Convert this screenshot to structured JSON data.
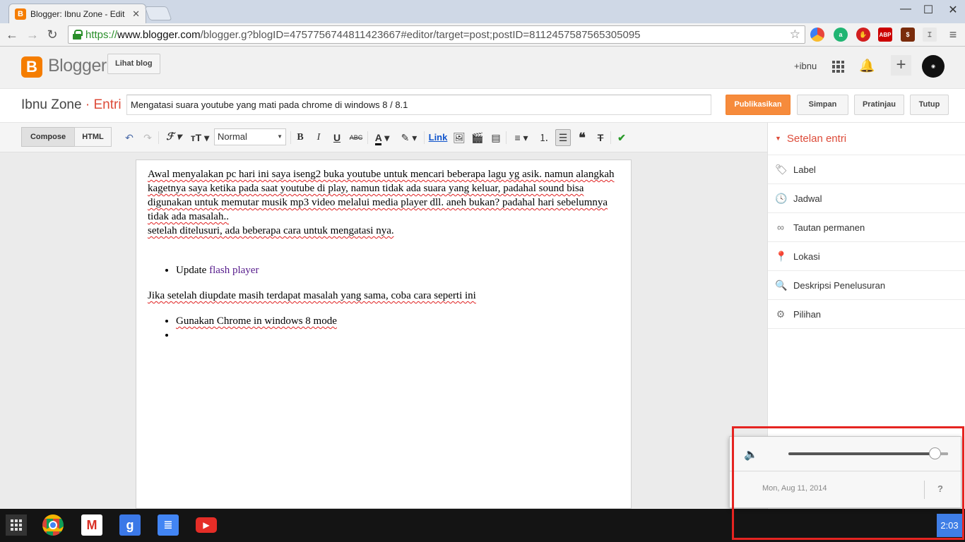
{
  "browser": {
    "tab_title": "Blogger: Ibnu Zone - Edit",
    "url_scheme": "https://",
    "url_host": "www.blogger.com",
    "url_rest": "/blogger.g?blogID=4757756744811423667#editor/target=post;postID=8112457587565305095",
    "extensions": [
      "ABP"
    ]
  },
  "blogger": {
    "logo_word": "Blogger",
    "view_blog": "Lihat blog",
    "user": "+ibnu",
    "blog_name": "Ibnu Zone",
    "section": "Entri",
    "post_title": "Mengatasi suara youtube yang mati pada chrome di windows 8 / 8.1",
    "publish": "Publikasikan",
    "save": "Simpan",
    "preview": "Pratinjau",
    "close": "Tutup"
  },
  "editor": {
    "mode_compose": "Compose",
    "mode_html": "HTML",
    "format_select": "Normal",
    "link_label": "Link"
  },
  "content": {
    "p1_a": "Awal menyalakan pc hari ini saya iseng2 buka youtube untuk mencari beberapa lagu yg asik. namun alangkah kagetnya saya ketika pada saat youtube di play, namun tidak ada suara yang keluar, padahal sound bisa digunakan untuk memutar musik mp3 video melalui media player dll. aneh bukan? padahal hari sebelumnya tidak ada masalah..",
    "p1_b": "setelah ditelusuri, ada beberapa cara untuk mengatasi nya.",
    "bullet1_prefix": "Update ",
    "bullet1_link": "flash player",
    "p2": "Jika setelah diupdate masih terdapat masalah yang sama, coba cara seperti ini",
    "bullet2": "Gunakan Chrome in windows 8 mode",
    "bullet3": ""
  },
  "sidebar": {
    "heading": "Setelan entri",
    "items": [
      {
        "label": "Label",
        "icon": "tag-icon"
      },
      {
        "label": "Jadwal",
        "icon": "clock-icon"
      },
      {
        "label": "Tautan permanen",
        "icon": "link-icon"
      },
      {
        "label": "Lokasi",
        "icon": "location-pin-icon"
      },
      {
        "label": "Deskripsi Penelusuran",
        "icon": "search-icon"
      },
      {
        "label": "Pilihan",
        "icon": "gear-icon"
      }
    ]
  },
  "system_tray": {
    "volume_level": 0.92,
    "date": "Mon, Aug 11, 2014",
    "help": "?",
    "time": "2:03"
  },
  "colors": {
    "accent": "#dd4b39",
    "blogger_orange": "#f57d00",
    "publish_button": "#f68b3c",
    "highlight_box": "#e52421",
    "clock_bg": "#3f7ee6"
  }
}
